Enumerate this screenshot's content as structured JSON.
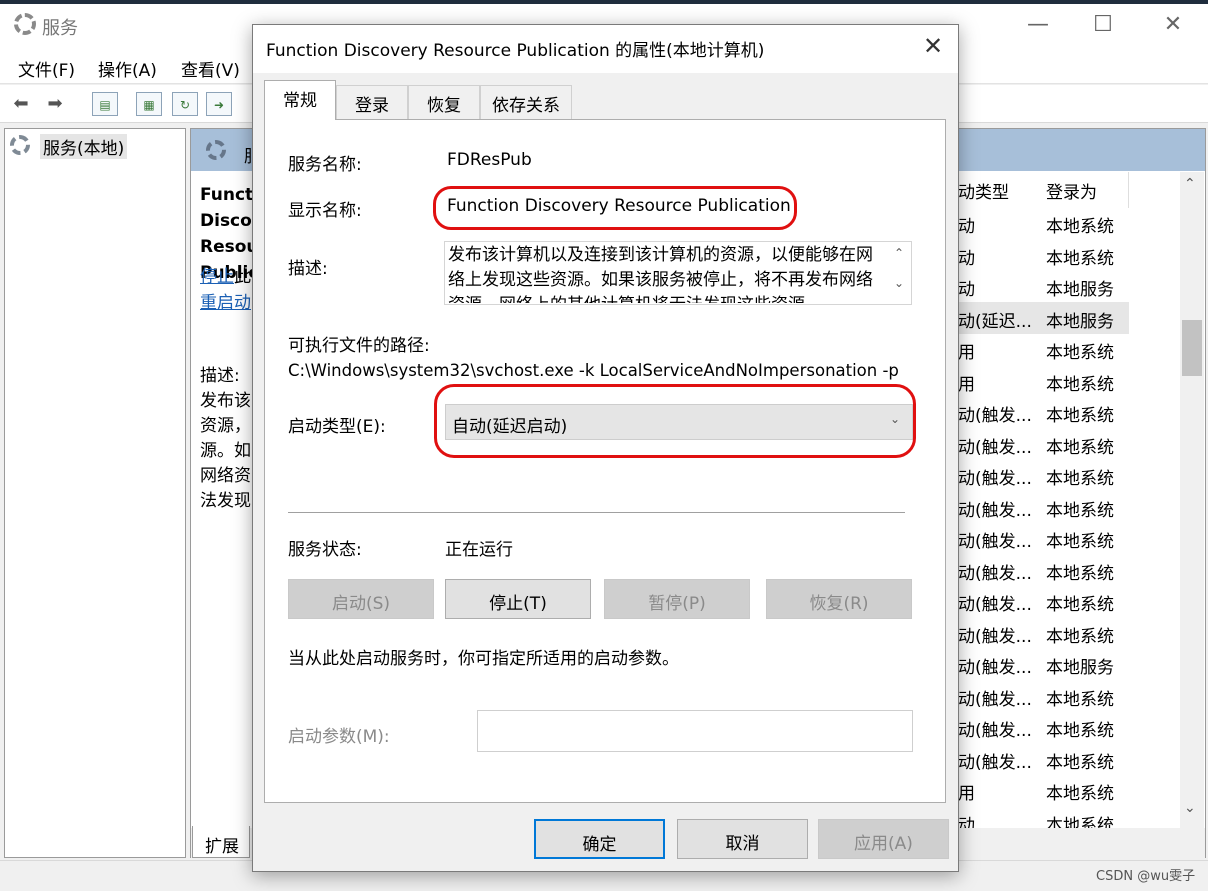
{
  "app": {
    "title": "服务",
    "menu": [
      "文件(F)",
      "操作(A)",
      "查看(V)"
    ],
    "window_controls": {
      "minimize": "—",
      "maximize": "☐",
      "close": "✕"
    }
  },
  "left_pane": {
    "item": "服务(本地)"
  },
  "middle_pane": {
    "header": "服务",
    "selected_title": "Function Discovery Resource Publication",
    "link_stop": "停止",
    "link_stop_suffix": "此",
    "link_restart": "重启动",
    "desc_label": "描述:",
    "desc_lines": [
      "发布该",
      "资源，",
      "源。如",
      "网络资",
      "法发现"
    ],
    "bottom_tab": "扩展"
  },
  "services_list": {
    "col_startup": "动类型",
    "col_logon": "登录为",
    "rows": [
      {
        "startup": "动",
        "logon": "本地系统"
      },
      {
        "startup": "动",
        "logon": "本地系统"
      },
      {
        "startup": "动",
        "logon": "本地服务"
      },
      {
        "startup": "动(延迟...",
        "logon": "本地服务"
      },
      {
        "startup": "用",
        "logon": "本地系统"
      },
      {
        "startup": "用",
        "logon": "本地系统"
      },
      {
        "startup": "动(触发...",
        "logon": "本地系统"
      },
      {
        "startup": "动(触发...",
        "logon": "本地系统"
      },
      {
        "startup": "动(触发...",
        "logon": "本地系统"
      },
      {
        "startup": "动(触发...",
        "logon": "本地系统"
      },
      {
        "startup": "动(触发...",
        "logon": "本地系统"
      },
      {
        "startup": "动(触发...",
        "logon": "本地系统"
      },
      {
        "startup": "动(触发...",
        "logon": "本地系统"
      },
      {
        "startup": "动(触发...",
        "logon": "本地系统"
      },
      {
        "startup": "动(触发...",
        "logon": "本地服务"
      },
      {
        "startup": "动(触发...",
        "logon": "本地系统"
      },
      {
        "startup": "动(触发...",
        "logon": "本地系统"
      },
      {
        "startup": "动(触发...",
        "logon": "本地系统"
      },
      {
        "startup": "用",
        "logon": "本地系统"
      },
      {
        "startup": "动",
        "logon": "本地系统"
      }
    ]
  },
  "dialog": {
    "title": "Function Discovery Resource Publication 的属性(本地计算机)",
    "close": "✕",
    "tabs": [
      "常规",
      "登录",
      "恢复",
      "依存关系"
    ],
    "service_name_label": "服务名称:",
    "service_name": "FDResPub",
    "display_name_label": "显示名称:",
    "display_name": "Function Discovery Resource Publication",
    "description_label": "描述:",
    "description": "发布该计算机以及连接到该计算机的资源，以便能够在网络上发现这些资源。如果该服务被停止，将不再发布网络资源，网络上的其他计算机将无法发现这些资源。",
    "exe_path_label": "可执行文件的路径:",
    "exe_path": "C:\\Windows\\system32\\svchost.exe -k LocalServiceAndNoImpersonation -p",
    "startup_type_label": "启动类型(E):",
    "startup_type": "自动(延迟启动)",
    "status_label": "服务状态:",
    "status": "正在运行",
    "buttons": {
      "start": "启动(S)",
      "stop": "停止(T)",
      "pause": "暂停(P)",
      "resume": "恢复(R)"
    },
    "params_hint": "当从此处启动服务时，你可指定所适用的启动参数。",
    "params_label": "启动参数(M):",
    "params_value": "",
    "footer": {
      "ok": "确定",
      "cancel": "取消",
      "apply": "应用(A)"
    }
  },
  "watermark": "CSDN @wu雯子",
  "colors": {
    "highlight_ring": "#e01010",
    "pane_header": "#a7bfd9",
    "link": "#1a5fb4"
  }
}
